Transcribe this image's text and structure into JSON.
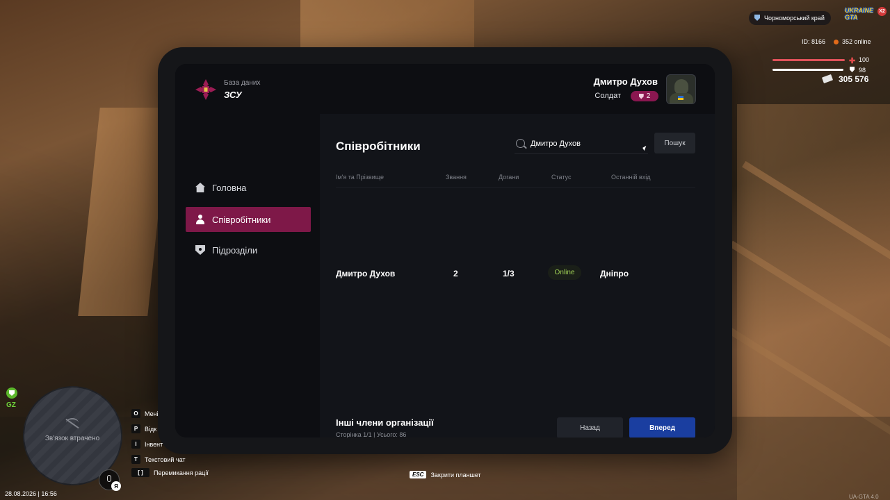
{
  "header": {
    "db_label": "База даних",
    "org_name": "ЗСУ",
    "user_name": "Дмитро Духов",
    "user_rank_title": "Солдат",
    "user_rank_level": "2"
  },
  "sidebar": {
    "items": [
      {
        "label": "Головна",
        "icon": "home-icon"
      },
      {
        "label": "Співробітники",
        "icon": "people-icon",
        "active": true
      },
      {
        "label": "Підрозділи",
        "icon": "shield-icon"
      }
    ]
  },
  "main": {
    "title": "Співробітники",
    "search_value": "Дмитро Духов",
    "search_button": "Пошук",
    "columns": [
      "Ім'я та Прізвище",
      "Звання",
      "Догани",
      "Статус",
      "Останній вхід"
    ],
    "rows": [
      {
        "name": "Дмитро Духов",
        "rank": "2",
        "reprimands": "1/3",
        "status": "Online",
        "last_login": "Дніпро"
      }
    ],
    "footer_title": "Інші члени організації",
    "footer_info": "Сторінка 1/1 | Усього: 86",
    "back_button": "Назад",
    "next_button": "Вперед"
  },
  "hud": {
    "region": "Чорноморський край",
    "game_logo": "UKRAINE GTA",
    "multiplier": "X2",
    "player_id": "ID: 8166",
    "online": "352 online",
    "health": "100",
    "armor": "98",
    "money": "305 576",
    "zone_label": "GZ",
    "signal_lost": "Зв'язок втрачено",
    "lang": "Я",
    "datetime": "28.08.2026 | 16:56",
    "hints": [
      {
        "key": "O",
        "label": "Мені"
      },
      {
        "key": "P",
        "label": "Відк"
      },
      {
        "key": "I",
        "label": "Інвент"
      },
      {
        "key": "T",
        "label": "Текстовий чат"
      },
      {
        "key": "[ ]",
        "label": "Перемикання рації"
      }
    ],
    "esc_key": "ESC",
    "esc_label": "Закрити планшет",
    "version": "UA-GTA 4.0"
  },
  "colors": {
    "accent": "#7e1848",
    "primary_button": "#1a3ea0",
    "status_online": "#9fcf55"
  }
}
